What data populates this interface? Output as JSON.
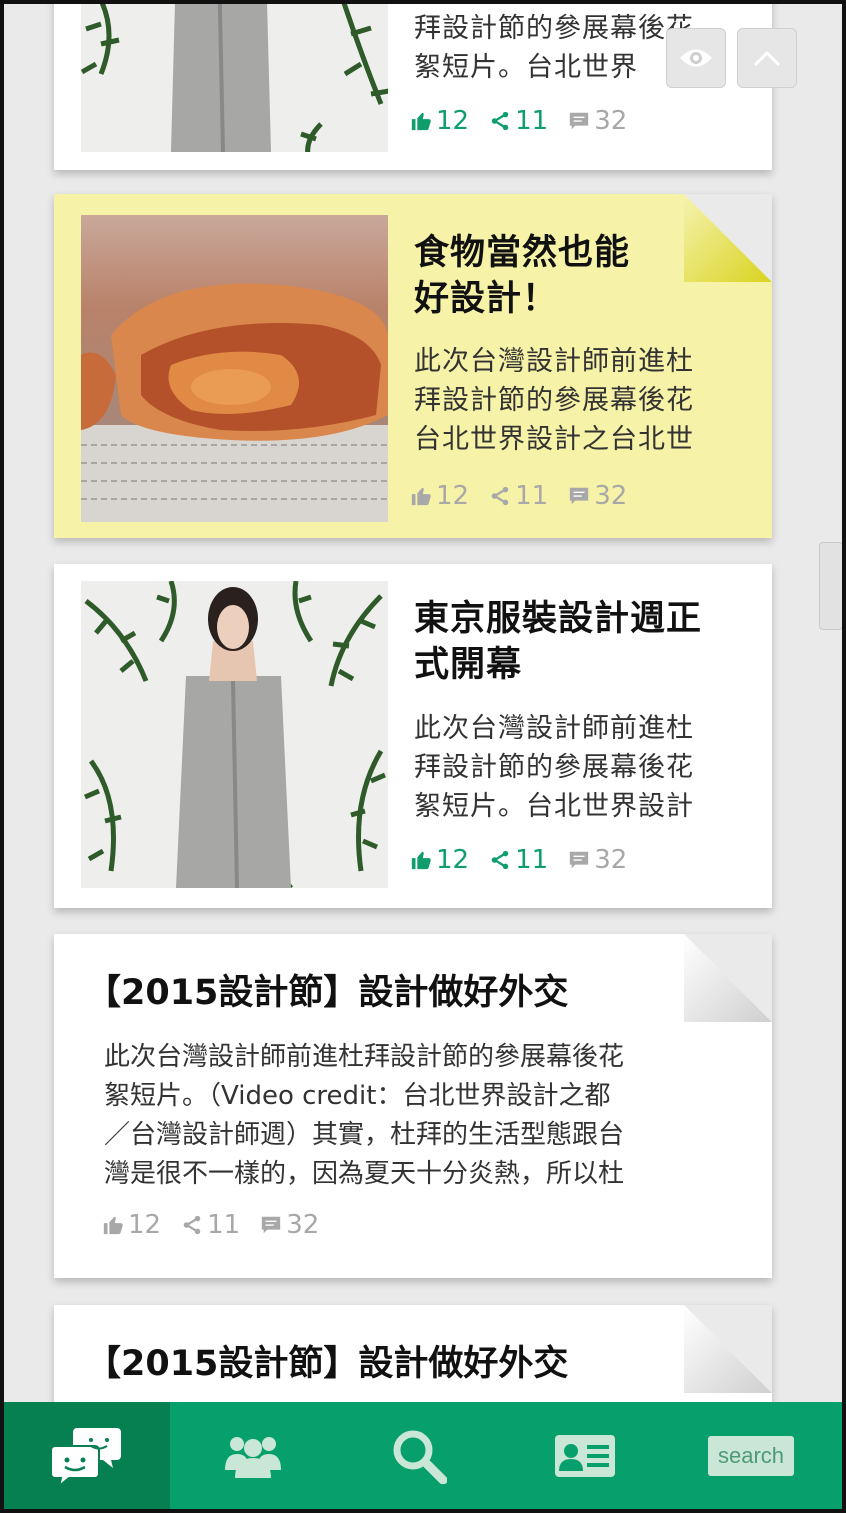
{
  "floating": {
    "eye_icon": "eye-icon",
    "up_icon": "chevron-up-icon"
  },
  "cards": [
    {
      "title": "",
      "excerpt_lines": [
        "拜設計節的參展幕後花",
        "絮短片。台北世界"
      ],
      "likes": "12",
      "shares": "11",
      "comments": "32"
    },
    {
      "title_lines": [
        "食物當然也能",
        "好設計！"
      ],
      "excerpt_lines": [
        "此次台灣設計師前進杜",
        "拜設計節的參展幕後花",
        "台北世界設計之台北世"
      ],
      "likes": "12",
      "shares": "11",
      "comments": "32"
    },
    {
      "title_lines": [
        "東京服裝設計週正",
        "式開幕"
      ],
      "excerpt_lines": [
        "此次台灣設計師前進杜",
        "拜設計節的參展幕後花",
        "絮短片。台北世界設計"
      ],
      "likes": "12",
      "shares": "11",
      "comments": "32"
    },
    {
      "title": "【2015設計節】設計做好外交",
      "excerpt_lines": [
        "此次台灣設計師前進杜拜設計節的參展幕後花",
        "絮短片。（Video credit：台北世界設計之都",
        "／台灣設計師週）其實，杜拜的生活型態跟台",
        "灣是很不一樣的，因為夏天十分炎熱，所以杜"
      ],
      "likes": "12",
      "shares": "11",
      "comments": "32"
    },
    {
      "title": "【2015設計節】設計做好外交"
    }
  ],
  "tabbar": {
    "tabs": [
      "chat-icon",
      "people-icon",
      "search-icon",
      "profile-card-icon"
    ],
    "search_label": "search"
  },
  "colors": {
    "green": "#07a06c",
    "green_dark": "#068051",
    "highlight": "#f6f3a8",
    "stat_green": "#0f9d6b",
    "stat_grey": "#a8a8a8"
  }
}
